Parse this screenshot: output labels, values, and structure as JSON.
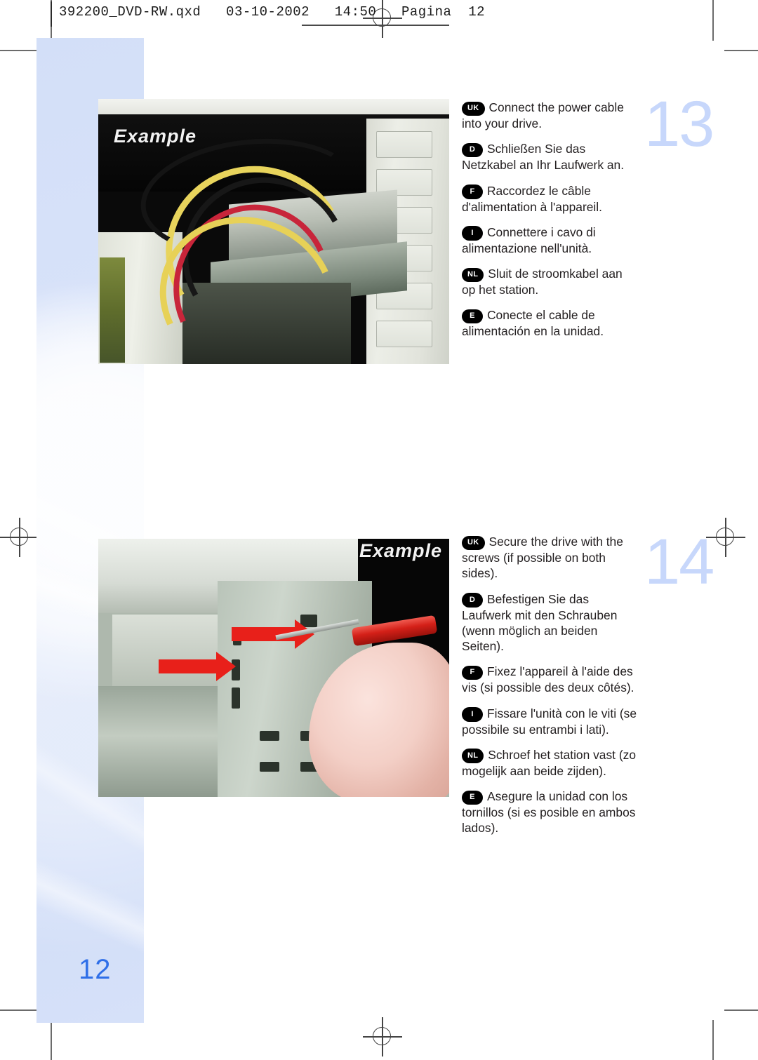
{
  "prepress": {
    "slug": "392200_DVD-RW.qxd   03-10-2002   14:50   Pagina  12"
  },
  "page": {
    "page_number": "12"
  },
  "steps": [
    {
      "number": "13",
      "photo_caption": "Example",
      "paragraphs": [
        {
          "lang": "UK",
          "text": "Connect the power cable into your drive."
        },
        {
          "lang": "D",
          "text": "Schließen Sie das Netzkabel an Ihr Laufwerk an."
        },
        {
          "lang": "F",
          "text": "Raccordez le câble d'alimentation à l'appareil."
        },
        {
          "lang": "I",
          "text": "Connettere i cavo di alimentazione nell'unità."
        },
        {
          "lang": "NL",
          "text": "Sluit de stroomkabel aan op het station."
        },
        {
          "lang": "E",
          "text": "Conecte el cable de alimentación en la unidad."
        }
      ]
    },
    {
      "number": "14",
      "photo_caption": "Example",
      "paragraphs": [
        {
          "lang": "UK",
          "text": "Secure the drive with the screws (if possible on both sides)."
        },
        {
          "lang": "D",
          "text": "Befestigen Sie das Laufwerk mit den Schrauben (wenn möglich an beiden Seiten)."
        },
        {
          "lang": "F",
          "text": "Fixez l'appareil à l'aide des vis (si possible des deux côtés)."
        },
        {
          "lang": "I",
          "text": "Fissare l'unità con le viti (se possibile su entrambi i lati)."
        },
        {
          "lang": "NL",
          "text": "Schroef het station vast (zo mogelijk aan beide zijden)."
        },
        {
          "lang": "E",
          "text": "Asegure la unidad con los tornillos (si es posible en ambos lados)."
        }
      ]
    }
  ],
  "colors": {
    "band_blue": "#d4dff8",
    "step_number_blue": "#c7d7fb",
    "page_number_blue": "#2f6fe8",
    "arrow_red": "#e8201a",
    "badge_black": "#000000"
  }
}
